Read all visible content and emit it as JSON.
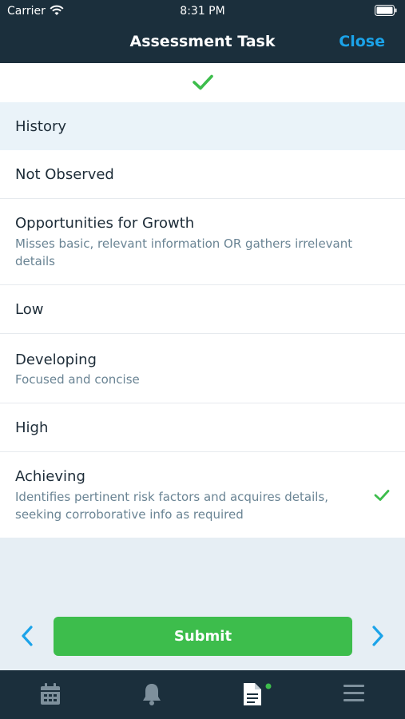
{
  "status_bar": {
    "carrier": "Carrier",
    "time": "8:31 PM"
  },
  "nav": {
    "title": "Assessment Task",
    "close_label": "Close"
  },
  "colors": {
    "accent_blue": "#1ba3e9",
    "success_green": "#3dbd4c",
    "header_dark": "#1b2f3c"
  },
  "sections": [
    {
      "title": "History",
      "type": "header"
    },
    {
      "title": "Not Observed",
      "description": ""
    },
    {
      "title": "Opportunities for Growth",
      "description": "Misses basic, relevant information OR gathers irrelevant details"
    },
    {
      "title": "Low",
      "description": ""
    },
    {
      "title": "Developing",
      "description": "Focused and concise"
    },
    {
      "title": "High",
      "description": ""
    },
    {
      "title": "Achieving",
      "description": "Identifies pertinent risk factors and acquires details, seeking corroborative info as required",
      "selected": true
    }
  ],
  "footer": {
    "submit_label": "Submit"
  },
  "tabs": [
    {
      "icon": "calendar-icon"
    },
    {
      "icon": "bell-icon"
    },
    {
      "icon": "document-icon",
      "active": true,
      "badge": true
    },
    {
      "icon": "menu-icon"
    }
  ]
}
